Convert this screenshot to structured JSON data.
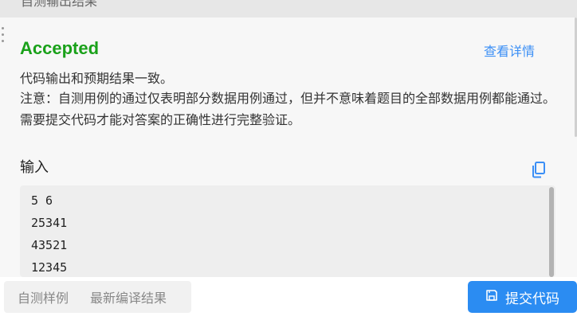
{
  "header": {
    "title": "自测输出结果"
  },
  "result": {
    "status": "Accepted",
    "status_color": "#1aa11a",
    "details_link": "查看详情",
    "message_line1": "代码输出和预期结果一致。",
    "message_line2": "注意：自测用例的通过仅表明部分数据用例通过，但并不意味着题目的全部数据用例都能通过。需要提交代码才能对答案的正确性进行完整验证。"
  },
  "input": {
    "label": "输入",
    "copy_icon": "copy-icon",
    "lines": [
      "5 6",
      "25341",
      "43521",
      "12345"
    ]
  },
  "bottom": {
    "tabs": [
      {
        "label": "自测样例"
      },
      {
        "label": "最新编译结果"
      }
    ],
    "submit_label": "提交代码",
    "submit_icon": "save-icon",
    "accent_color": "#2b8cf2"
  }
}
